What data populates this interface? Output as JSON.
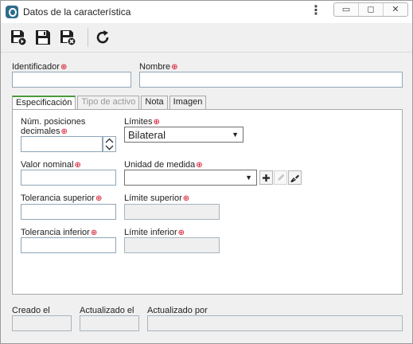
{
  "window": {
    "title": "Datos de la característica",
    "menu_glyph": "⋮",
    "controls": {
      "minimize": "▭",
      "maximize": "◻",
      "close": "✕"
    }
  },
  "toolbar": {
    "buttons": [
      {
        "name": "save-new-icon",
        "tooltip": ""
      },
      {
        "name": "save-icon",
        "tooltip": ""
      },
      {
        "name": "save-close-icon",
        "tooltip": ""
      },
      {
        "name": "refresh-icon",
        "tooltip": ""
      }
    ]
  },
  "header_fields": {
    "identificador": {
      "label": "Identificador",
      "value": ""
    },
    "nombre": {
      "label": "Nombre",
      "value": ""
    }
  },
  "required_marker": "⊕",
  "tabs": [
    {
      "label": "Especificación",
      "active": true,
      "disabled": false
    },
    {
      "label": "Tipo de activo",
      "active": false,
      "disabled": true
    },
    {
      "label": "Nota",
      "active": false,
      "disabled": false
    },
    {
      "label": "Imagen",
      "active": false,
      "disabled": false
    }
  ],
  "specification": {
    "decimal_positions": {
      "label_line1": "Núm. posiciones",
      "label_line2": "decimales",
      "value": ""
    },
    "limits": {
      "label": "Límites",
      "selected": "Bilateral"
    },
    "nominal_value": {
      "label": "Valor nominal",
      "value": ""
    },
    "unit": {
      "label": "Unidad de medida",
      "selected": ""
    },
    "upper_tolerance": {
      "label": "Tolerancia superior",
      "value": ""
    },
    "upper_limit": {
      "label": "Límite superior",
      "value": ""
    },
    "lower_tolerance": {
      "label": "Tolerancia inferior",
      "value": ""
    },
    "lower_limit": {
      "label": "Límite inferior",
      "value": ""
    }
  },
  "footer_fields": {
    "created": {
      "label": "Creado el",
      "value": ""
    },
    "updated": {
      "label": "Actualizado el",
      "value": ""
    },
    "updated_by": {
      "label": "Actualizado por",
      "value": ""
    }
  }
}
